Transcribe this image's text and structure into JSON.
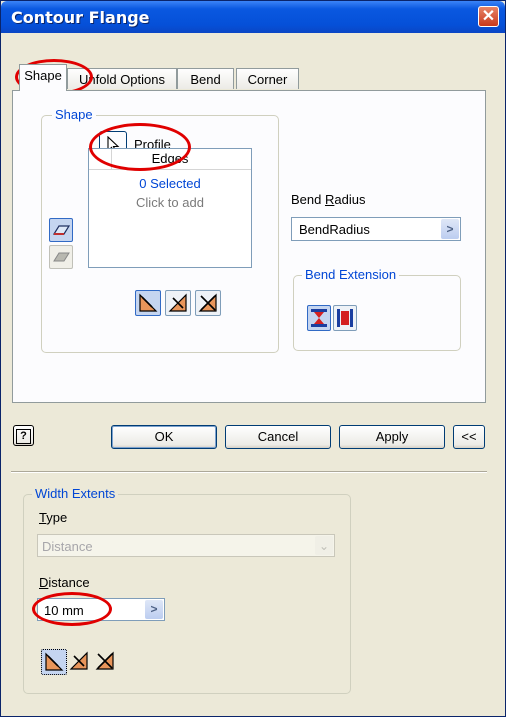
{
  "window": {
    "title": "Contour Flange",
    "close_glyph": "✕"
  },
  "tabs": [
    {
      "label": "Shape",
      "active": true
    },
    {
      "label": "Unfold Options",
      "active": false
    },
    {
      "label": "Bend",
      "active": false
    },
    {
      "label": "Corner",
      "active": false
    }
  ],
  "shape_group": {
    "title": "Shape",
    "profile_button": {
      "label_first": "P",
      "label_rest": "rofile",
      "icon": "cursor-arrow-icon"
    },
    "edges": {
      "header": "Edges",
      "selected": "0 Selected",
      "hint": "Click to add"
    }
  },
  "bend_radius": {
    "label_first": "Bend ",
    "label_accel": "R",
    "label_rest": "adius",
    "value": "BendRadius",
    "arrow": ">"
  },
  "bend_extension": {
    "title": "Bend Extension"
  },
  "buttons": {
    "help": "?",
    "ok": "OK",
    "cancel": "Cancel",
    "apply": "Apply",
    "collapse": "<<"
  },
  "width_extents": {
    "title": "Width Extents",
    "type_label_accel": "T",
    "type_label_rest": "ype",
    "type_value": "Distance",
    "distance_label_accel": "D",
    "distance_label_rest": "istance",
    "distance_value": "10 mm",
    "distance_arrow": ">"
  },
  "colors": {
    "accent_blue": "#0046d5",
    "highlight_red": "#e00000",
    "titlebar": "#0550d8"
  }
}
